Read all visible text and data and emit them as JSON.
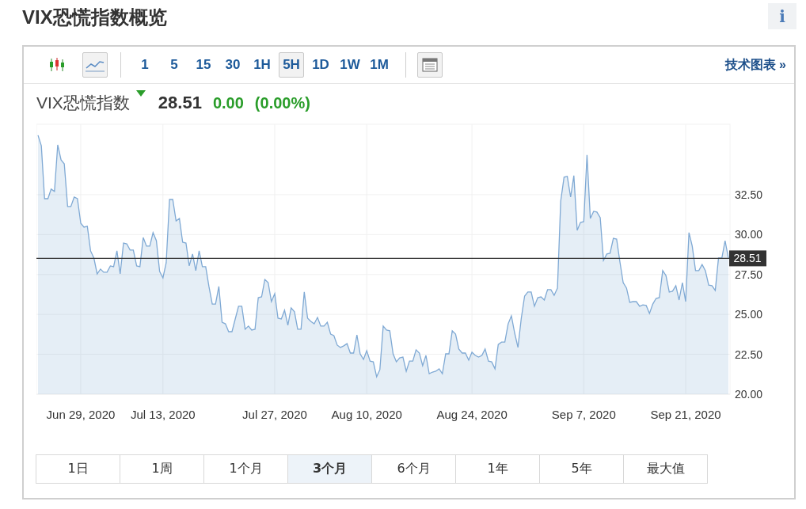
{
  "title": "VIX恐慌指数概览",
  "info_button": {
    "label": "i"
  },
  "toolbar": {
    "chart_types": [
      {
        "kind": "candlestick",
        "selected": false
      },
      {
        "kind": "line",
        "selected": true
      }
    ],
    "intervals": [
      {
        "label": "1",
        "selected": false
      },
      {
        "label": "5",
        "selected": false
      },
      {
        "label": "15",
        "selected": false
      },
      {
        "label": "30",
        "selected": false
      },
      {
        "label": "1H",
        "selected": false
      },
      {
        "label": "5H",
        "selected": true
      },
      {
        "label": "1D",
        "selected": false
      },
      {
        "label": "1W",
        "selected": false
      },
      {
        "label": "1M",
        "selected": false
      }
    ],
    "technical_chart_link": "技术图表 »"
  },
  "quote": {
    "name": "VIX恐慌指数",
    "last": "28.51",
    "change": "0.00",
    "change_percent": "(0.00%)"
  },
  "chart_data": {
    "type": "area",
    "grid": true,
    "ylim": [
      20,
      36.91
    ],
    "categories": [
      null,
      null,
      null,
      null,
      null,
      null,
      null,
      null,
      null,
      null,
      null,
      null,
      null,
      "Jun 29, 2020",
      null,
      null,
      null,
      null,
      null,
      null,
      null,
      null,
      null,
      null,
      null,
      null,
      null,
      null,
      null,
      null,
      null,
      null,
      null,
      null,
      null,
      null,
      null,
      null,
      "Jul 13, 2020",
      null,
      null,
      null,
      null,
      null,
      null,
      null,
      null,
      null,
      null,
      null,
      null,
      null,
      null,
      null,
      null,
      null,
      null,
      null,
      null,
      null,
      null,
      null,
      null,
      null,
      null,
      null,
      null,
      null,
      null,
      null,
      null,
      null,
      "Jul 27, 2020",
      null,
      null,
      null,
      null,
      null,
      null,
      null,
      null,
      null,
      null,
      null,
      null,
      null,
      null,
      null,
      null,
      null,
      null,
      null,
      null,
      null,
      null,
      null,
      null,
      null,
      null,
      null,
      "Aug 10, 2020",
      null,
      null,
      null,
      null,
      null,
      null,
      null,
      null,
      null,
      null,
      null,
      null,
      null,
      null,
      null,
      null,
      null,
      null,
      null,
      null,
      null,
      null,
      null,
      null,
      null,
      null,
      null,
      null,
      null,
      null,
      null,
      "Aug 24, 2020",
      null,
      null,
      null,
      null,
      null,
      null,
      null,
      null,
      null,
      null,
      null,
      null,
      null,
      null,
      null,
      null,
      null,
      null,
      null,
      null,
      null,
      null,
      null,
      null,
      null,
      null,
      null,
      null,
      null,
      null,
      null,
      null,
      null,
      "Sep 7, 2020",
      null,
      null,
      null,
      null,
      null,
      null,
      null,
      null,
      null,
      null,
      null,
      null,
      null,
      null,
      null,
      null,
      null,
      null,
      null,
      null,
      null,
      null,
      null,
      null,
      null,
      null,
      null,
      null,
      null,
      null,
      "Sep 21, 2020",
      null,
      null,
      null,
      null,
      null,
      null,
      null,
      null,
      null,
      null,
      null,
      null,
      null
    ],
    "series": [
      {
        "color": "#7fa9d4",
        "values": [
          36.22,
          35.57,
          32.25,
          32.25,
          32.85,
          32.7,
          35.62,
          34.68,
          34.43,
          31.76,
          31.76,
          32.35,
          32.25,
          30.71,
          30.47,
          30.52,
          28.98,
          28.53,
          27.54,
          27.84,
          27.64,
          27.64,
          28.04,
          27.99,
          28.98,
          27.54,
          29.47,
          29.42,
          29.03,
          29.03,
          28.04,
          27.99,
          29.82,
          29.28,
          29.28,
          30.12,
          29.62,
          27.69,
          27.29,
          28.23,
          32.2,
          32.2,
          30.86,
          31.01,
          29.52,
          29.47,
          28.04,
          28.78,
          27.74,
          28.98,
          27.99,
          27.99,
          26.75,
          25.65,
          25.65,
          26.75,
          24.51,
          24.41,
          23.92,
          23.92,
          24.71,
          25.51,
          25.51,
          24.07,
          24.27,
          24.02,
          24.07,
          26.05,
          26.1,
          27.19,
          26.99,
          25.8,
          26.3,
          24.76,
          24.71,
          25.26,
          24.32,
          25.41,
          25.16,
          24.07,
          24.07,
          26.4,
          24.76,
          24.56,
          24.41,
          24.81,
          24.27,
          24.27,
          24.51,
          23.77,
          23.67,
          23.08,
          22.93,
          23.03,
          23.17,
          22.58,
          22.58,
          23.72,
          22.53,
          22.18,
          22.73,
          22.08,
          22.03,
          21.09,
          21.54,
          24.27,
          24.02,
          23.97,
          22.53,
          22.03,
          22.28,
          22.33,
          21.44,
          22.08,
          22.08,
          22.78,
          22.58,
          21.79,
          22.43,
          21.29,
          21.39,
          21.44,
          21.59,
          21.29,
          22.53,
          22.53,
          23.97,
          23.77,
          22.83,
          22.58,
          22.58,
          22.13,
          22.63,
          22.43,
          22.33,
          22.43,
          22.83,
          22.08,
          22.03,
          21.59,
          23.12,
          23.27,
          23.27,
          24.41,
          24.91,
          23.82,
          22.93,
          24.76,
          26.15,
          26.4,
          26.4,
          25.51,
          26.05,
          26.1,
          25.9,
          26.55,
          26.55,
          26.2,
          26.65,
          32.1,
          33.59,
          33.64,
          32.35,
          33.69,
          30.27,
          30.76,
          30.81,
          34.98,
          31.01,
          31.46,
          31.41,
          31.06,
          28.38,
          28.78,
          28.83,
          29.77,
          29.72,
          28.28,
          26.99,
          26.65,
          25.75,
          25.8,
          25.8,
          25.51,
          25.6,
          25.56,
          25.06,
          25.65,
          26.0,
          26.05,
          27.74,
          27.44,
          26.4,
          26.45,
          26.8,
          25.9,
          26.99,
          25.8,
          30.12,
          29.28,
          27.74,
          27.74,
          28.13,
          27.74,
          26.84,
          26.8,
          26.5,
          28.53,
          28.53,
          29.62,
          28.53
        ]
      }
    ],
    "yticks": [
      {
        "value": 20,
        "label": "20.00"
      },
      {
        "value": 22.5,
        "label": "22.50"
      },
      {
        "value": 25,
        "label": "25.00"
      },
      {
        "value": 27.5,
        "label": "27.50"
      },
      {
        "value": 30,
        "label": "30.00"
      },
      {
        "value": 32.5,
        "label": "32.50"
      }
    ],
    "ref_lines": [
      {
        "axis": "y",
        "value": 28.51,
        "label": "28.51",
        "color": "#333333"
      }
    ]
  },
  "ranges": [
    {
      "label": "1日",
      "selected": false
    },
    {
      "label": "1周",
      "selected": false
    },
    {
      "label": "1个月",
      "selected": false
    },
    {
      "label": "3个月",
      "selected": true
    },
    {
      "label": "6个月",
      "selected": false
    },
    {
      "label": "1年",
      "selected": false
    },
    {
      "label": "5年",
      "selected": false
    },
    {
      "label": "最大值",
      "selected": false
    }
  ]
}
